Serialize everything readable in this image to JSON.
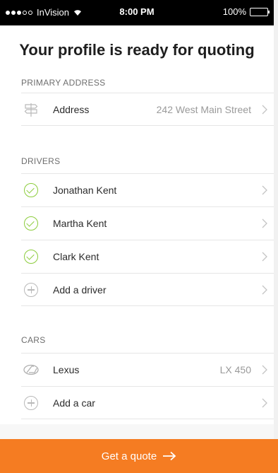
{
  "status_bar": {
    "carrier": "InVision",
    "time": "8:00 PM",
    "battery": "100%"
  },
  "title": "Your profile is ready for quoting",
  "primary_address": {
    "header": "PRIMARY ADDRESS",
    "label": "Address",
    "value": "242 West Main Street"
  },
  "drivers": {
    "header": "DRIVERS",
    "items": [
      {
        "label": "Jonathan Kent",
        "status": "complete"
      },
      {
        "label": "Martha Kent",
        "status": "complete"
      },
      {
        "label": "Clark Kent",
        "status": "complete"
      }
    ],
    "add_label": "Add a driver"
  },
  "cars": {
    "header": "CARS",
    "items": [
      {
        "label": "Lexus",
        "value": "LX 450",
        "icon": "lexus-logo-icon"
      }
    ],
    "add_label": "Add a car"
  },
  "cta": {
    "label": "Get a quote",
    "icon": "arrow-right-icon"
  },
  "colors": {
    "accent": "#f57c22",
    "check": "#8ccc3c"
  }
}
